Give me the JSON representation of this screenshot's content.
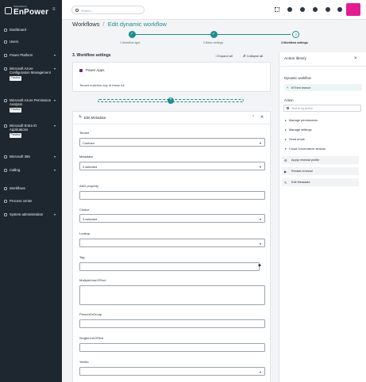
{
  "brand": {
    "tagline": "SharePoint's",
    "name": "EnPower"
  },
  "sidebar": {
    "items": [
      {
        "label": "Dashboard",
        "badge": ""
      },
      {
        "label": "Users",
        "badge": ""
      },
      {
        "label": "Power Platform",
        "badge": ""
      },
      {
        "label": "Microsoft Azure Configuration Management",
        "badge": "Preview"
      },
      {
        "label": "Microsoft Azure Permission Analysis",
        "badge": "Preview"
      },
      {
        "label": "Microsoft Entra ID Applications",
        "badge": "Preview"
      },
      {
        "label": "Microsoft 365",
        "badge": ""
      },
      {
        "label": "Calling",
        "badge": ""
      },
      {
        "label": "Workflows",
        "badge": ""
      },
      {
        "label": "Process center",
        "badge": ""
      },
      {
        "label": "System administration",
        "badge": ""
      }
    ]
  },
  "topbar": {
    "search_placeholder": "Search..."
  },
  "breadcrumb": {
    "root": "Workflows",
    "separator": "/",
    "current": "Edit dynamic workflow"
  },
  "stepper": {
    "steps": [
      {
        "label": "1.Workflow type",
        "state": "done"
      },
      {
        "label": "2.Basic settings",
        "state": "done"
      },
      {
        "label": "3.Workflow settings",
        "state": "current",
        "number": "3"
      }
    ]
  },
  "main": {
    "title": "3. Workflow settings",
    "expand_all": "Expand all",
    "collapse_all": "Collapse all",
    "power_apps": {
      "title": "Power Apps",
      "condition": "Tenant matches any of these All"
    },
    "edit_metadata": {
      "title": "Edit Metadata",
      "fields": [
        {
          "label": "Tenant",
          "value": "Contoso",
          "type": "select"
        },
        {
          "label": "Metadata",
          "value": "3 selected",
          "type": "select"
        },
        {
          "label": "AAD property",
          "value": "",
          "type": "text"
        },
        {
          "label": "Choice",
          "value": "3 selected",
          "type": "select"
        },
        {
          "label": "Lookup",
          "value": "",
          "type": "select"
        },
        {
          "label": "Tag",
          "value": "",
          "type": "tag"
        },
        {
          "label": "MultipleLineOfText",
          "value": "",
          "type": "textarea"
        },
        {
          "label": "PersonOrGroup",
          "value": "",
          "type": "text"
        },
        {
          "label": "SingleLineOfText",
          "value": "",
          "type": "text"
        },
        {
          "label": "YesNo",
          "value": "",
          "type": "select"
        }
      ]
    }
  },
  "library": {
    "title": "Action library",
    "dynamic_workflow_label": "Dynamic workflow",
    "dynamic_workflow_item": "If/Then branch",
    "action_label": "Action",
    "search_placeholder": "Search by action",
    "groups": [
      "Manage permissions",
      "Manage settings",
      "Send email",
      "Cloud Governance actions"
    ],
    "actions": [
      "Apply renewal profile",
      "Restart renewal",
      "Edit Metadata"
    ]
  },
  "colors": {
    "accent": "#1d8c8f",
    "sidebar": "#1e2730",
    "avatar": "#e21d91"
  }
}
